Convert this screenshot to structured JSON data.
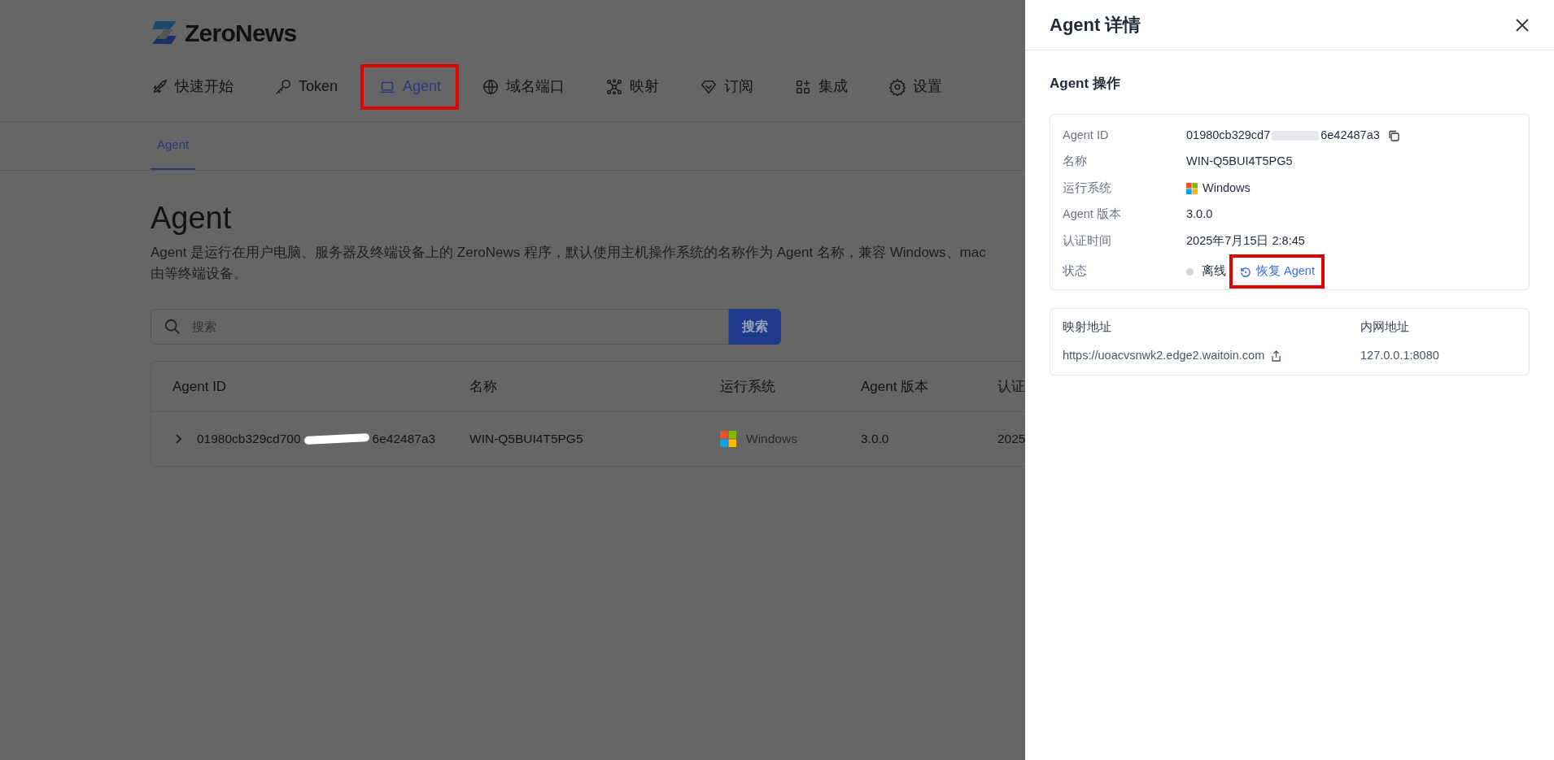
{
  "brand": {
    "name": "ZeroNews"
  },
  "nav": [
    {
      "label": "快速开始",
      "selected": false,
      "highlighted": false
    },
    {
      "label": "Token",
      "selected": false,
      "highlighted": false
    },
    {
      "label": "Agent",
      "selected": true,
      "highlighted": true
    },
    {
      "label": "域名端口",
      "selected": false,
      "highlighted": false
    },
    {
      "label": "映射",
      "selected": false,
      "highlighted": false
    },
    {
      "label": "订阅",
      "selected": false,
      "highlighted": false
    },
    {
      "label": "集成",
      "selected": false,
      "highlighted": false
    },
    {
      "label": "设置",
      "selected": false,
      "highlighted": false
    }
  ],
  "subtabs": [
    {
      "label": "Agent",
      "selected": true
    }
  ],
  "page": {
    "title": "Agent",
    "description": [
      "Agent 是运行在用户电脑、服务器及终端设备上的 ZeroNews 程序，默认使用主机操作系统的名称作为 Agent 名称，兼容 Windows、mac",
      "由等终端设备。"
    ]
  },
  "search": {
    "placeholder": "搜索",
    "button": "搜索"
  },
  "table": {
    "columns": [
      "Agent ID",
      "名称",
      "运行系统",
      "Agent 版本",
      "认证"
    ],
    "rows": [
      {
        "expanded": false,
        "id_start": "01980cb329cd700",
        "id_end": "6e42487a3",
        "name": "WIN-Q5BUI4T5PG5",
        "os": "Windows",
        "version": "3.0.0",
        "column_5": "2025"
      }
    ]
  },
  "panel": {
    "title": "Agent 详情",
    "section": "Agent 操作",
    "fields": [
      {
        "label": "Agent ID",
        "kind": "id",
        "value_start": "01980cb329cd7",
        "value_end": "6e42487a3"
      },
      {
        "label": "名称",
        "kind": "text",
        "value": "WIN-Q5BUI4T5PG5"
      },
      {
        "label": "运行系统",
        "kind": "os",
        "value": "Windows"
      },
      {
        "label": "Agent 版本",
        "kind": "text",
        "value": "3.0.0"
      },
      {
        "label": "认证时间",
        "kind": "text",
        "value": "2025年7月15日 2:8:45"
      },
      {
        "label": "状态",
        "kind": "status",
        "value": "离线",
        "color": "#d1d5db",
        "action": "恢复 Agent",
        "highlighted": true
      }
    ],
    "mapping": {
      "columns": [
        "映射地址",
        "内网地址"
      ],
      "values": [
        "https://uoacvsnwk2.edge2.waitoin.com",
        "127.0.0.1:8080"
      ]
    }
  }
}
